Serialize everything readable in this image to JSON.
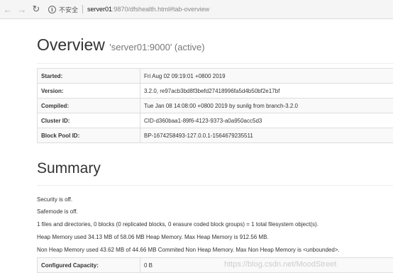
{
  "browser": {
    "security_label": "不安全",
    "url_host": "server01",
    "url_rest": ":9870/dfshealth.html#tab-overview"
  },
  "overview": {
    "title": "Overview",
    "subtitle": "'server01:9000' (active)",
    "rows": [
      {
        "key": "Started:",
        "value": "Fri Aug 02 09:19:01 +0800 2019"
      },
      {
        "key": "Version:",
        "value": "3.2.0, re97acb3bd8f3befd27418996fa5d4b50bf2e17bf"
      },
      {
        "key": "Compiled:",
        "value": "Tue Jan 08 14:08:00 +0800 2019 by sunilg from branch-3.2.0"
      },
      {
        "key": "Cluster ID:",
        "value": "CID-d360baa1-89f6-4123-9373-a0a950acc5d3"
      },
      {
        "key": "Block Pool ID:",
        "value": "BP-1674258493-127.0.0.1-1564679235511"
      }
    ]
  },
  "summary": {
    "title": "Summary",
    "security": "Security is off.",
    "safemode": "Safemode is off.",
    "files": "1 files and directories, 0 blocks (0 replicated blocks, 0 erasure coded block groups) = 1 total filesystem object(s).",
    "heap": "Heap Memory used 34.13 MB of 58.06 MB Heap Memory. Max Heap Memory is 912.56 MB.",
    "nonheap": "Non Heap Memory used 43.62 MB of 44.66 MB Commited Non Heap Memory. Max Non Heap Memory is <unbounded>.",
    "rows": [
      {
        "key": "Configured Capacity:",
        "value": "0 B"
      }
    ]
  },
  "watermark": "https://blog.csdn.net/MoodStreet"
}
